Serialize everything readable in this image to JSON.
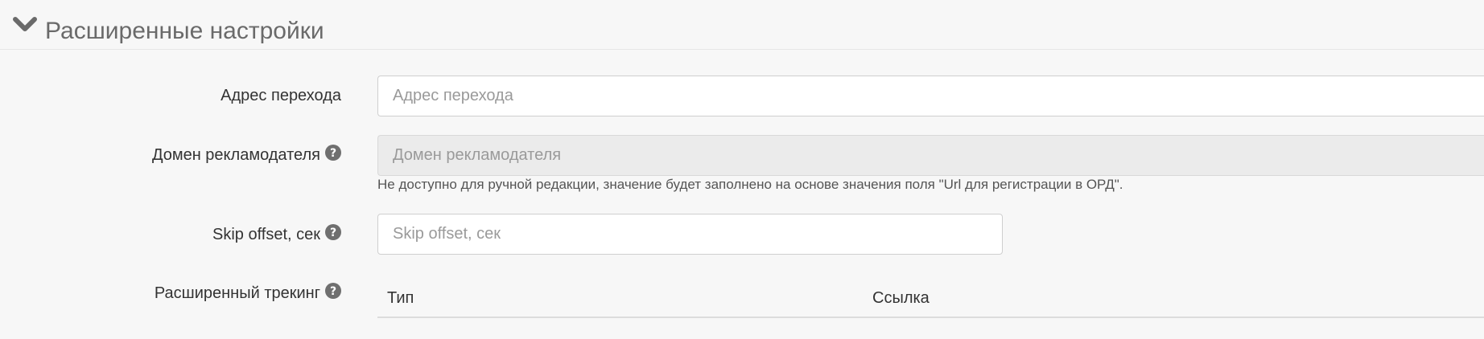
{
  "section": {
    "title": "Расширенные настройки",
    "icon": "chevron-down-icon"
  },
  "fields": {
    "redirect_url": {
      "label": "Адрес перехода",
      "placeholder": "Адрес перехода",
      "value": ""
    },
    "advertiser_domain": {
      "label": "Домен рекламодателя",
      "placeholder": "Домен рекламодателя",
      "value": "",
      "hint": "Не доступно для ручной редакции, значение будет заполнено на основе значения поля \"Url для регистрации в ОРД\"."
    },
    "skip_offset": {
      "label": "Skip offset, сек",
      "placeholder": "Skip offset, сек",
      "value": ""
    },
    "extended_tracking": {
      "label": "Расширенный трекинг",
      "columns": [
        "Тип",
        "Ссылка"
      ]
    }
  },
  "colors": {
    "background": "#f7f7f7",
    "help_icon": "#6f6f6f",
    "disabled_input": "#ebebeb"
  }
}
